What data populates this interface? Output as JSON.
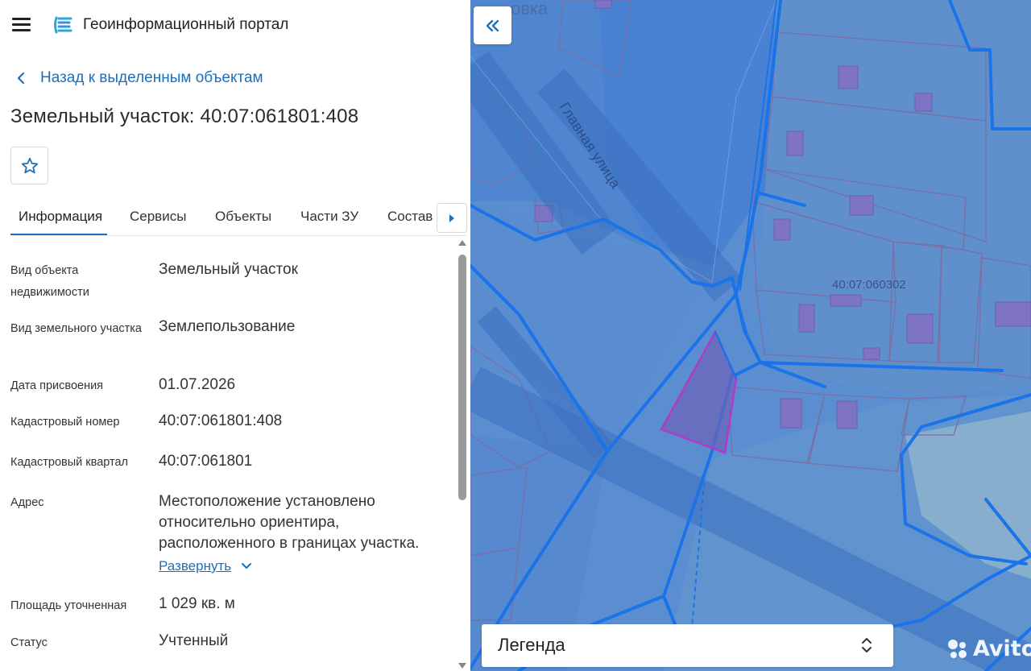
{
  "header": {
    "app_title": "Геоинформационный портал",
    "menu_icon": "hamburger-menu-icon",
    "logo_icon": "portal-logo-icon"
  },
  "back": {
    "label": "Назад к выделенным объектам"
  },
  "object": {
    "title": "Земельный участок: 40:07:061801:408"
  },
  "tabs": [
    {
      "label": "Информация",
      "active": true
    },
    {
      "label": "Сервисы"
    },
    {
      "label": "Объекты"
    },
    {
      "label": "Части ЗУ"
    },
    {
      "label": "Состав"
    }
  ],
  "fields": [
    {
      "label": "Вид объекта недвижимости",
      "value": "Земельный участок"
    },
    {
      "label": "Вид земельного участка",
      "value": "Землепользование"
    },
    {
      "label": "Дата присвоения",
      "value": "01.07.2026"
    },
    {
      "label": "Кадастровый номер",
      "value": "40:07:061801:408"
    },
    {
      "label": "Кадастровый квартал",
      "value": "40:07:061801"
    },
    {
      "label": "Адрес",
      "value": "Местоположение установлено относительно ориентира, расположенного в границах участка."
    },
    {
      "label": "Площадь уточненная",
      "value": "1 029 кв. м"
    },
    {
      "label": "Статус",
      "value": "Учтенный"
    }
  ],
  "expand_label": "Развернуть",
  "map": {
    "street_label": "Главная улица",
    "quarter_label": "40:07:060302",
    "top_partial_label": "овка",
    "legend_label": "Легенда"
  },
  "watermark": "Avito",
  "colors": {
    "accent": "#1e6fb8",
    "map_base": "#5b8fd0",
    "boundary": "#1a73e8",
    "selected_parcel": "#b23ac8"
  }
}
